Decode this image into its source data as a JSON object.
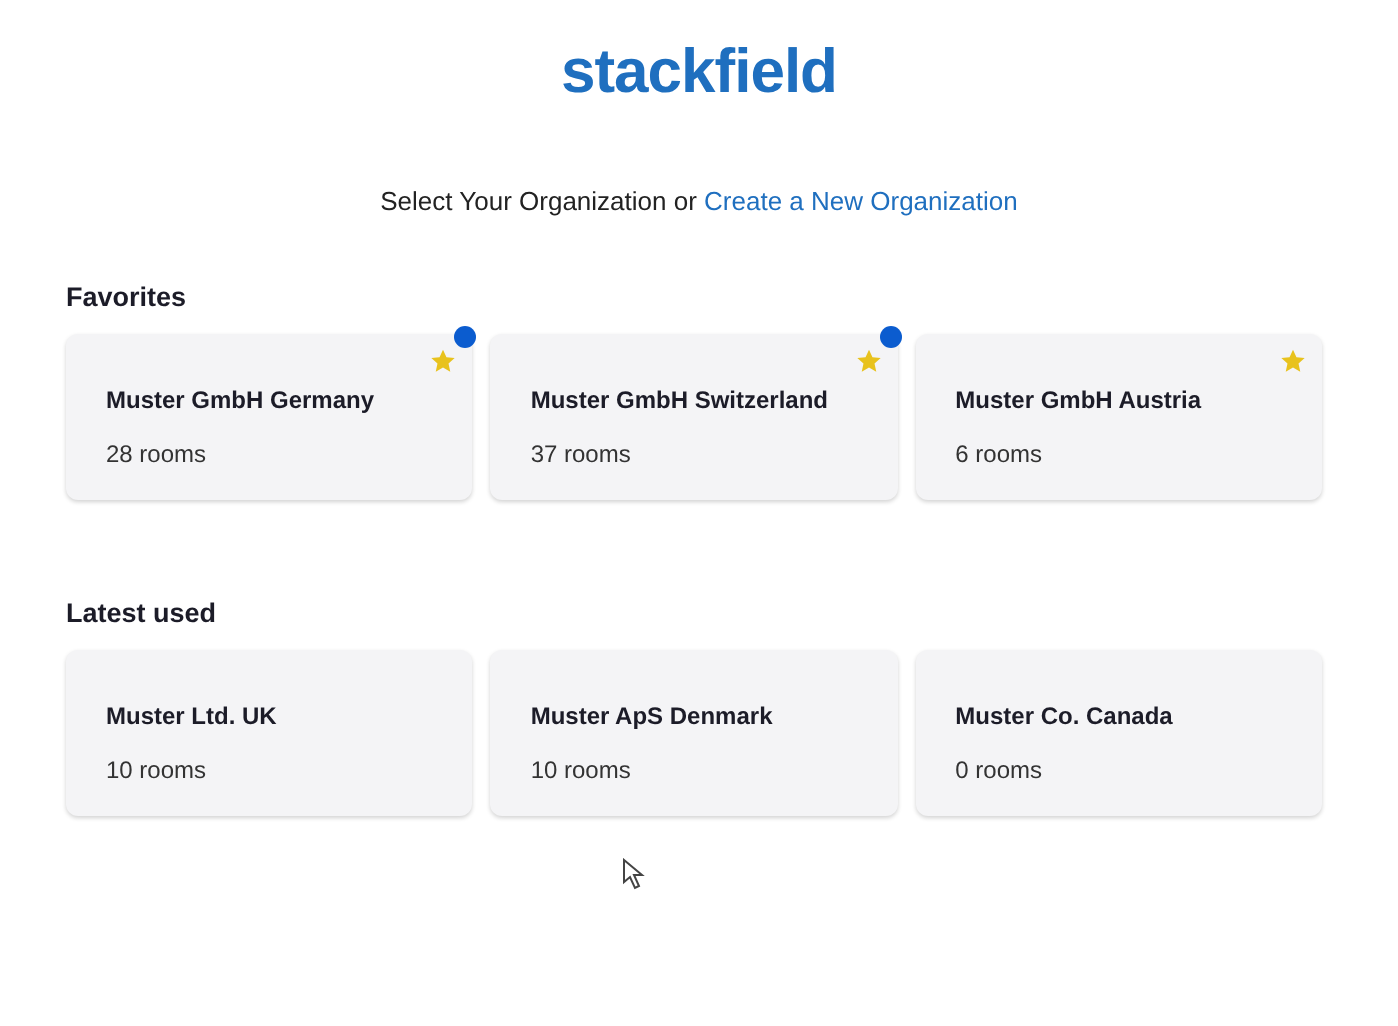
{
  "logo": "stackfield",
  "subtitle": {
    "text": "Select Your Organization or",
    "link": "Create a New Organization"
  },
  "sections": [
    {
      "title": "Favorites",
      "organizations": [
        {
          "name": "Muster GmbH Germany",
          "rooms": "28 rooms",
          "favorite": true,
          "unread": true
        },
        {
          "name": "Muster GmbH Switzerland",
          "rooms": "37 rooms",
          "favorite": true,
          "unread": true
        },
        {
          "name": "Muster GmbH Austria",
          "rooms": "6 rooms",
          "favorite": true,
          "unread": false
        }
      ]
    },
    {
      "title": "Latest used",
      "organizations": [
        {
          "name": "Muster Ltd. UK",
          "rooms": "10 rooms",
          "favorite": false,
          "unread": false
        },
        {
          "name": "Muster ApS Denmark",
          "rooms": "10 rooms",
          "favorite": false,
          "unread": false
        },
        {
          "name": "Muster Co. Canada",
          "rooms": "0 rooms",
          "favorite": false,
          "unread": false
        }
      ]
    }
  ]
}
